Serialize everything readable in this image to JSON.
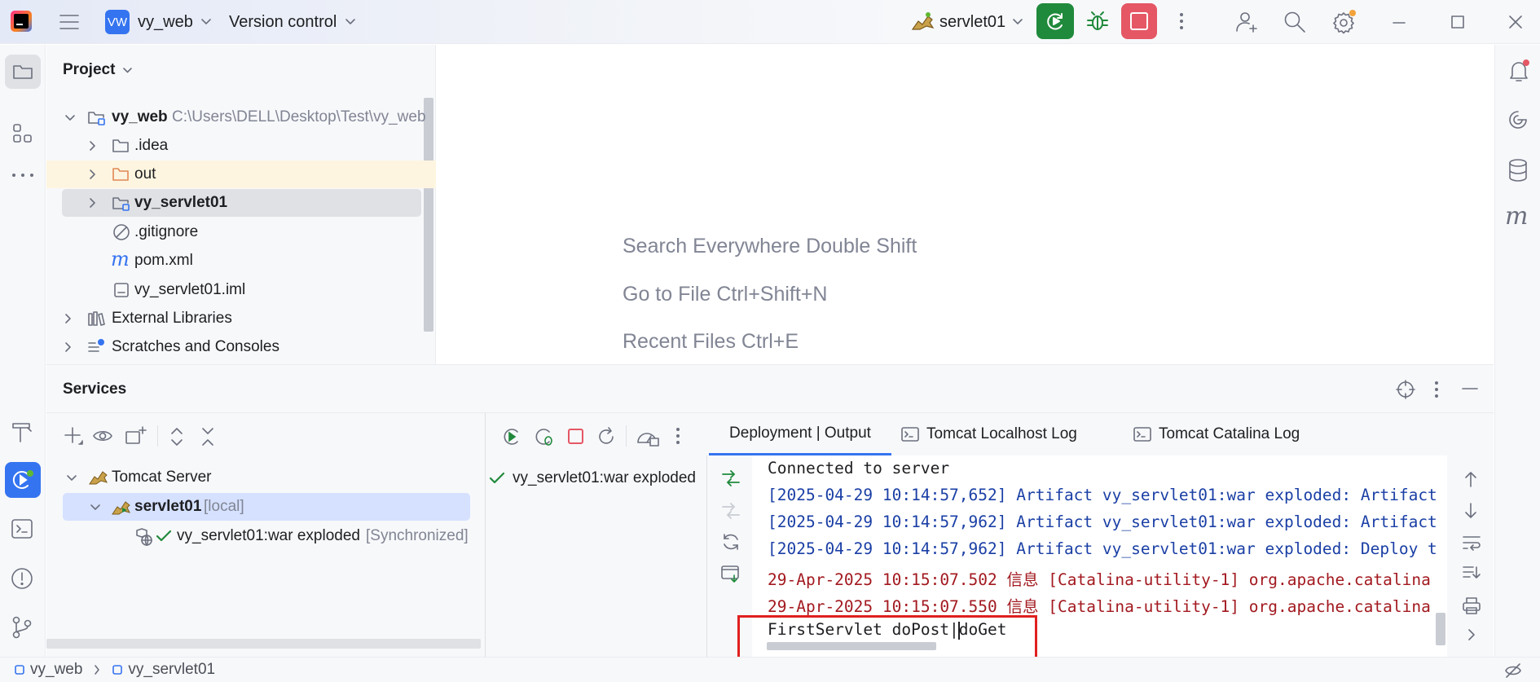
{
  "titlebar": {
    "project_badge": "VW",
    "project_name": "vy_web",
    "version_control": "Version control",
    "run_config": "servlet01"
  },
  "project_panel": {
    "title": "Project",
    "tree": [
      {
        "label": "vy_web",
        "path": "C:\\Users\\DELL\\Desktop\\Test\\vy_web"
      },
      {
        "label": ".idea"
      },
      {
        "label": "out"
      },
      {
        "label": "vy_servlet01"
      },
      {
        "label": ".gitignore"
      },
      {
        "label": "pom.xml"
      },
      {
        "label": "vy_servlet01.iml"
      },
      {
        "label": "External Libraries"
      },
      {
        "label": "Scratches and Consoles"
      }
    ]
  },
  "editor": {
    "hints": [
      "Search Everywhere Double Shift",
      "Go to File Ctrl+Shift+N",
      "Recent Files Ctrl+E"
    ]
  },
  "services": {
    "title": "Services",
    "tree": {
      "server": "Tomcat Server",
      "config": "servlet01",
      "config_suffix": "[local]",
      "artifact": "vy_servlet01:war exploded",
      "artifact_suffix": "[Synchronized]"
    },
    "deployment_item": "vy_servlet01:war exploded",
    "tabs": [
      "Deployment | Output",
      "Tomcat Localhost Log",
      "Tomcat Catalina Log"
    ],
    "console_lines": [
      {
        "text": "Connected to server",
        "color": "#1e1f22"
      },
      {
        "text": "[2025-04-29 10:14:57,652] Artifact vy_servlet01:war exploded: Artifact",
        "color": "#1a3fa5"
      },
      {
        "text": "[2025-04-29 10:14:57,962] Artifact vy_servlet01:war exploded: Artifact",
        "color": "#1a3fa5"
      },
      {
        "text": "[2025-04-29 10:14:57,962] Artifact vy_servlet01:war exploded: Deploy t",
        "color": "#1a3fa5"
      },
      {
        "text": "29-Apr-2025 10:15:07.502 信息 [Catalina-utility-1] org.apache.catalina",
        "color": "#a2191f"
      },
      {
        "text": "29-Apr-2025 10:15:07.550 信息 [Catalina-utility-1] org.apache.catalina",
        "color": "#a2191f"
      },
      {
        "text": "FirstServlet doPost|doGet",
        "color": "#1e1f22"
      }
    ]
  },
  "statusbar": {
    "crumb1": "vy_web",
    "crumb2": "vy_servlet01"
  },
  "colors": {
    "accent": "#3574f0",
    "run_green": "#208a3c",
    "stop_red": "#e55765",
    "highlight_box": "#e0201f",
    "selection": "#d5e1ff"
  }
}
